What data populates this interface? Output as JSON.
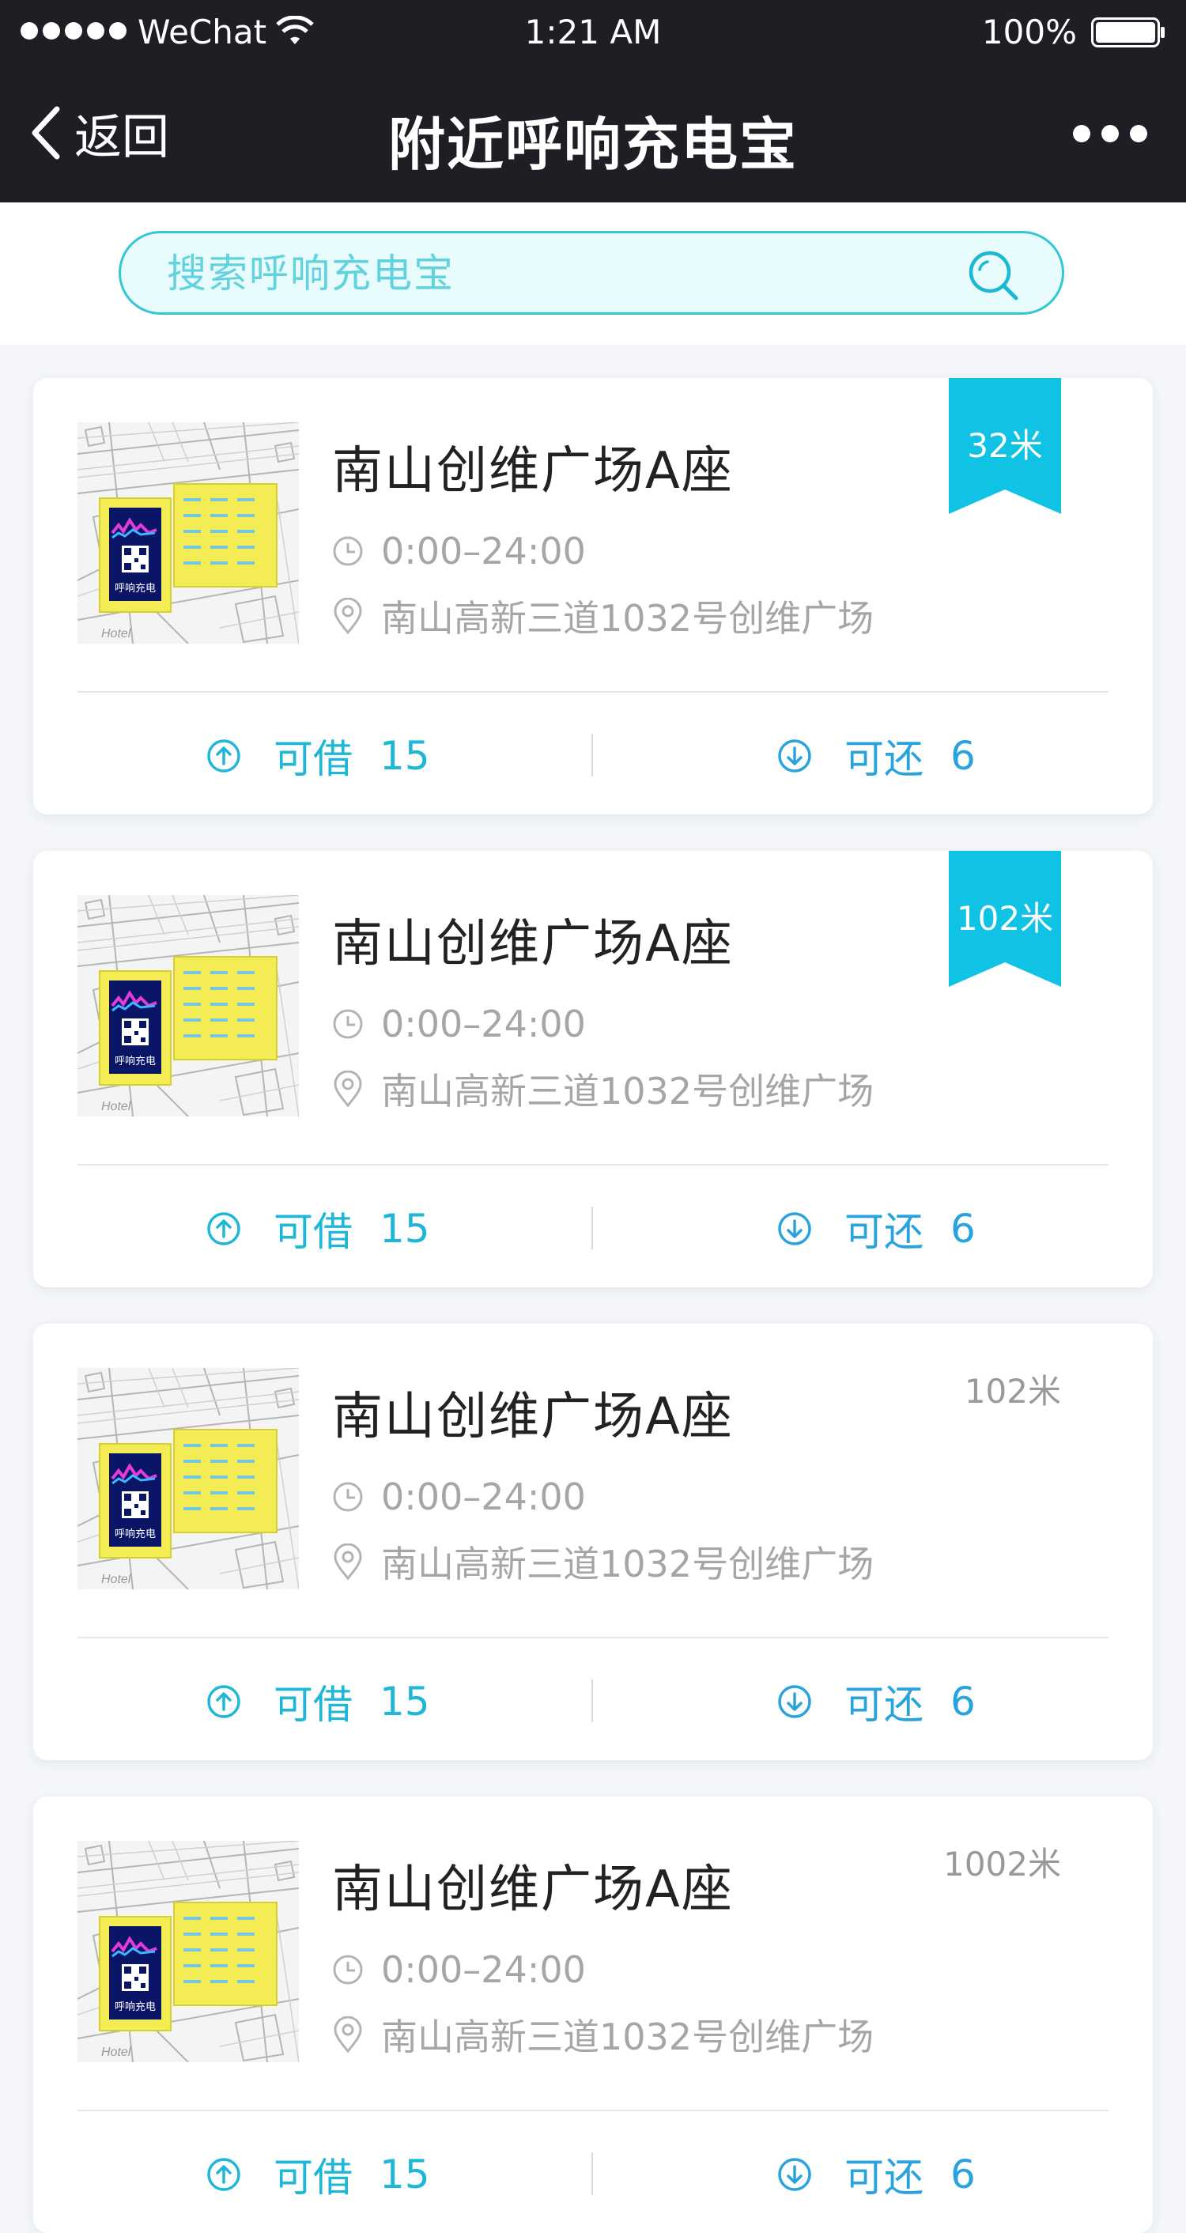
{
  "status_bar": {
    "carrier": "WeChat",
    "time": "1:21 AM",
    "battery": "100%"
  },
  "nav": {
    "back_label": "返回",
    "title": "附近呼响充电宝"
  },
  "search": {
    "placeholder": "搜索呼响充电宝"
  },
  "thumbnail_label": "Hotel",
  "thumbnail_sign": "呼响充电",
  "stations": [
    {
      "name": "南山创维广场A座",
      "hours": "0:00–24:00",
      "address": "南山高新三道1032号创维广场",
      "distance": "32米",
      "distance_style": "ribbon",
      "borrow_label": "可借",
      "borrow_count": "15",
      "return_label": "可还",
      "return_count": "6"
    },
    {
      "name": "南山创维广场A座",
      "hours": "0:00–24:00",
      "address": "南山高新三道1032号创维广场",
      "distance": "102米",
      "distance_style": "ribbon",
      "borrow_label": "可借",
      "borrow_count": "15",
      "return_label": "可还",
      "return_count": "6"
    },
    {
      "name": "南山创维广场A座",
      "hours": "0:00–24:00",
      "address": "南山高新三道1032号创维广场",
      "distance": "102米",
      "distance_style": "plain",
      "borrow_label": "可借",
      "borrow_count": "15",
      "return_label": "可还",
      "return_count": "6"
    },
    {
      "name": "南山创维广场A座",
      "hours": "0:00–24:00",
      "address": "南山高新三道1032号创维广场",
      "distance": "1002米",
      "distance_style": "plain",
      "borrow_label": "可借",
      "borrow_count": "15",
      "return_label": "可还",
      "return_count": "6"
    }
  ],
  "colors": {
    "accent": "#10c2e4",
    "nav_bg": "#1e1f24",
    "search_bg": "#e8fbfd"
  }
}
